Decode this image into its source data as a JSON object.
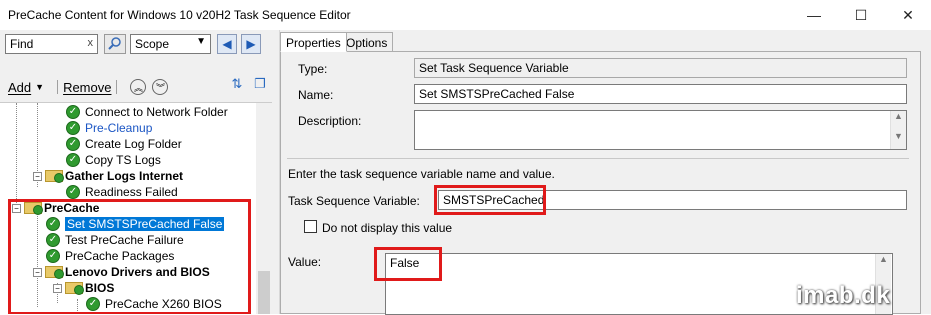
{
  "window": {
    "title": "PreCache Content for Windows 10 v20H2 Task Sequence Editor",
    "minimize_glyph": "—",
    "maximize_glyph": "☐",
    "close_glyph": "✕"
  },
  "left": {
    "find_value": "Find",
    "find_clear": "x",
    "scope_value": "Scope",
    "add_label": "Add",
    "remove_label": "Remove",
    "tree": [
      {
        "label": "Connect to Network Folder",
        "style": "normal"
      },
      {
        "label": "Pre-Cleanup",
        "style": "link"
      },
      {
        "label": "Create Log Folder",
        "style": "normal"
      },
      {
        "label": "Copy TS Logs",
        "style": "normal"
      },
      {
        "label": "Gather Logs Internet",
        "style": "bold"
      },
      {
        "label": "Readiness Failed",
        "style": "normal"
      },
      {
        "label": "PreCache",
        "style": "bold"
      },
      {
        "label": "Set SMSTSPreCached False",
        "style": "selected"
      },
      {
        "label": "Test PreCache Failure",
        "style": "normal"
      },
      {
        "label": "PreCache Packages",
        "style": "normal"
      },
      {
        "label": "Lenovo Drivers and BIOS",
        "style": "bold"
      },
      {
        "label": "BIOS",
        "style": "bold"
      },
      {
        "label": "PreCache X260 BIOS",
        "style": "normal"
      }
    ]
  },
  "right": {
    "tabs": [
      "Properties",
      "Options"
    ],
    "type_label": "Type:",
    "type_value": "Set Task Sequence Variable",
    "name_label": "Name:",
    "name_value": "Set SMSTSPreCached False",
    "description_label": "Description:",
    "description_value": "",
    "instruction": "Enter the task sequence variable name and value.",
    "tsvar_label": "Task Sequence Variable:",
    "tsvar_value": "SMSTSPreCached",
    "checkbox_label": "Do not display this value",
    "value_label": "Value:",
    "value_value": "False"
  },
  "watermark": "imab.dk",
  "colors": {
    "highlight_box": "#e01a1a",
    "selection": "#0078d7",
    "success_check": "#2f9a2f"
  }
}
